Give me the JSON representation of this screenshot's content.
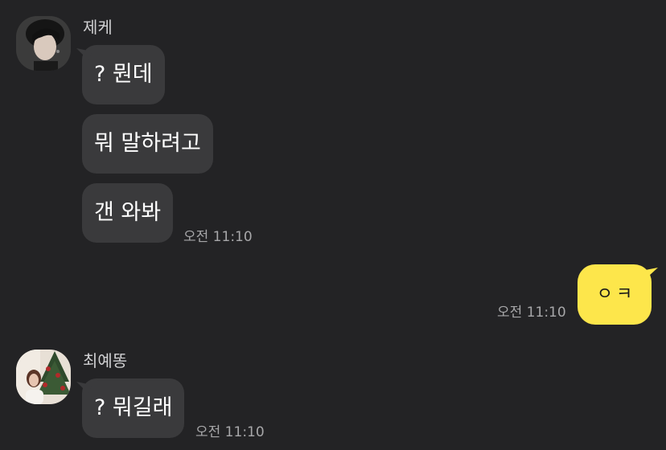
{
  "messages": {
    "group1": {
      "sender": "제케",
      "bubbles": [
        "? 뭔데",
        "뭐 말하려고",
        "갠 와봐"
      ],
      "time": "오전 11:10"
    },
    "mine": {
      "text": "ㅇㅋ",
      "time": "오전 11:10"
    },
    "group2": {
      "sender": "최예똥",
      "bubbles": [
        "? 뭐길래"
      ],
      "time": "오전 11:10"
    }
  },
  "colors": {
    "background": "#232325",
    "incoming_bubble": "#3a3a3c",
    "outgoing_bubble": "#fde64b"
  }
}
